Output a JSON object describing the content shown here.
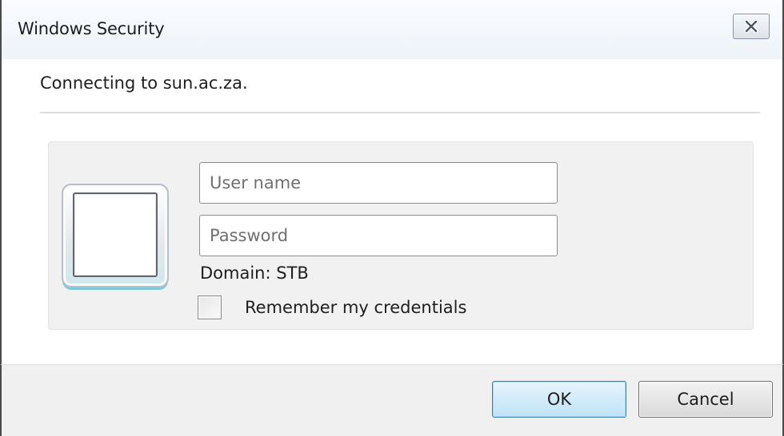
{
  "window": {
    "title": "Windows Security",
    "close_icon": "close-icon"
  },
  "message": {
    "connecting_text": "Connecting to sun.ac.za."
  },
  "credentials": {
    "user_tile_icon": "user-tile-icon",
    "username": {
      "value": "",
      "placeholder": "User name"
    },
    "password": {
      "value": "",
      "placeholder": "Password"
    },
    "domain_text": "Domain: STB",
    "remember": {
      "label": "Remember my credentials",
      "checked": false
    }
  },
  "buttons": {
    "ok_label": "OK",
    "cancel_label": "Cancel"
  },
  "colors": {
    "ok_button_border": "#3c7fb1",
    "ok_button_fill": "#d2ebfa",
    "footer_background": "#f0f0f0",
    "panel_background": "#f1f1f1"
  }
}
